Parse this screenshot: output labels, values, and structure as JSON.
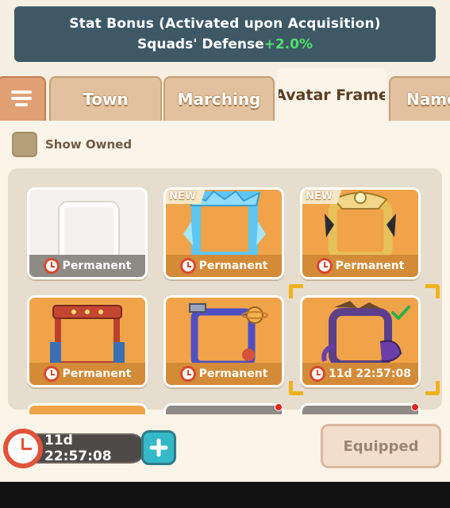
{
  "banner": {
    "title": "Stat Bonus (Activated upon Acquisition)",
    "stat_label": "Squads' Defense",
    "stat_value": "+2.0%"
  },
  "tabs": [
    {
      "label": "Town",
      "has_alert": true
    },
    {
      "label": "Marching",
      "has_alert": false
    },
    {
      "label": "Avatar Frame",
      "has_alert": true,
      "active": true
    },
    {
      "label": "Name",
      "has_alert": false
    }
  ],
  "filter": {
    "label": "Show Owned",
    "checked": false
  },
  "frames": [
    {
      "duration": "Permanent",
      "is_new": false,
      "style": "plain-white",
      "selected": false,
      "equipped": false
    },
    {
      "duration": "Permanent",
      "is_new": true,
      "new_label": "NEW",
      "style": "ice-crystal",
      "selected": false,
      "equipped": false
    },
    {
      "duration": "Permanent",
      "is_new": true,
      "new_label": "NEW",
      "style": "golden-ornate",
      "selected": false,
      "equipped": false
    },
    {
      "duration": "Permanent",
      "is_new": false,
      "style": "festival-stage",
      "selected": false,
      "equipped": false
    },
    {
      "duration": "Permanent",
      "is_new": false,
      "style": "space-satellite",
      "selected": false,
      "equipped": false
    },
    {
      "duration": "11d 22:57:08",
      "is_new": false,
      "style": "pirate-octopus",
      "selected": true,
      "equipped": true
    }
  ],
  "footer": {
    "timer": "11d 22:57:08",
    "equip_label": "Equipped"
  },
  "colors": {
    "banner_bg": "#3e5866",
    "bonus_green": "#4fe06a",
    "card_orange": "#f1a349",
    "alert_red": "#e8241d",
    "plus_teal": "#35b8c8"
  }
}
